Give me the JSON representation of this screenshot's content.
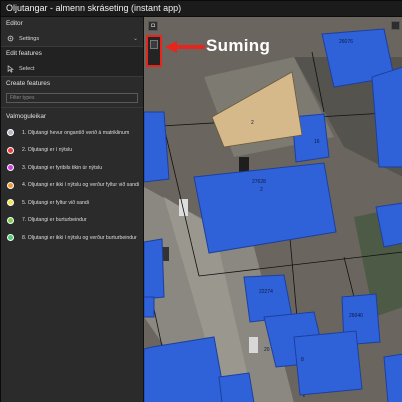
{
  "window": {
    "title": "Oljutangar - almenn skráseting (instant app)"
  },
  "panel": {
    "editor_heading": "Editor",
    "settings_label": "Settings",
    "edit_features_heading": "Edit features",
    "select_label": "Select",
    "create_features_heading": "Create features",
    "filter_placeholder": "Filter types",
    "valmoguleikar_heading": "Valmoguleikar"
  },
  "legend": [
    {
      "label": "1. Oljutangi hevur ongantíð verið á matriklinum",
      "color": "#b8b8c8"
    },
    {
      "label": "2. Oljutangi er í nýtslu",
      "color": "#f03c3c"
    },
    {
      "label": "3. Oljutangi er fyribils tikin úr nýtslu",
      "color": "#d040e0"
    },
    {
      "label": "4. Oljutangi er ikki í nýtslu og verður fyltur við sandi",
      "color": "#f09a2c"
    },
    {
      "label": "5. Oljutangi er fyltur við sandi",
      "color": "#f4e64a"
    },
    {
      "label": "7. Oljutangi er burturbeindur",
      "color": "#7ad04a"
    },
    {
      "label": "8. Oljutangi er ikki í nýtslu og verður burturbeindur",
      "color": "#4ad070"
    }
  ],
  "map": {
    "callout_text": "Suming",
    "parcel_labels": [
      "26076",
      "2",
      "27628",
      "16",
      "2",
      "22274",
      "26040",
      "8",
      "20"
    ],
    "colors": {
      "building": "#2f62d8",
      "building_edge": "#1d3f9e",
      "tan": "#d6b98a",
      "callout_arrow": "#e8251c"
    }
  },
  "icons": {
    "settings": "gear-icon",
    "select": "cursor-icon",
    "dropdown": "chevron-down-icon",
    "camera": "camera-icon"
  }
}
